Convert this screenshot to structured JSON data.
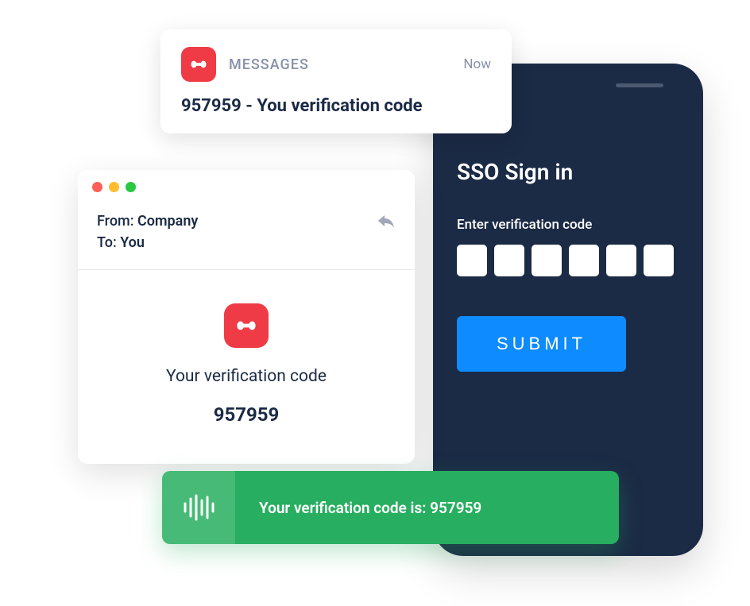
{
  "phone": {
    "title": "SSO Sign in",
    "label": "Enter verification code",
    "submit_label": "SUBMIT"
  },
  "notification": {
    "app_name": "MESSAGES",
    "timestamp": "Now",
    "body": "957959 - You verification code"
  },
  "email": {
    "from_label": "From: ",
    "from_value": "Company",
    "to_label": "To: ",
    "to_value": "You",
    "title": "Your verification code",
    "code": "957959"
  },
  "voice": {
    "text": "Your verification code is: 957959"
  },
  "colors": {
    "dark_navy": "#1b2a45",
    "red": "#ef3b45",
    "blue": "#0d8bff",
    "green": "#27ae60"
  }
}
